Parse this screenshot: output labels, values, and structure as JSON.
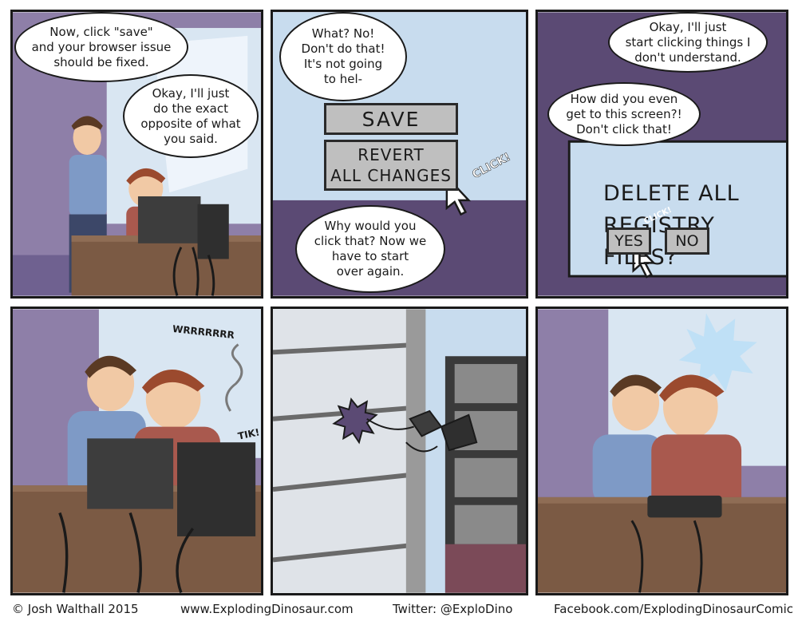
{
  "panel1": {
    "bubble_left": "Now, click \"save\"\nand your browser issue\nshould be fixed.",
    "bubble_right": "Okay, I'll just\ndo the exact\nopposite of what\nyou said."
  },
  "panel2": {
    "bubble_top": "What? No!\nDon't do that!\nIt's not going\nto hel-",
    "save_button": "SAVE",
    "revert_button": "REVERT\nALL CHANGES",
    "sfx_click": "CLICK!",
    "bubble_bottom": "Why would you\nclick that? Now we\nhave to start\nover again."
  },
  "panel3": {
    "bubble_top": "Okay, I'll just\nstart clicking things I\ndon't understand.",
    "bubble_mid": "How did you even\nget to this screen?!\nDon't click that!",
    "dialog_text": "DELETE ALL\nREGISTRY FILES?",
    "yes_button": "YES",
    "no_button": "NO",
    "sfx_click": "CLICK!"
  },
  "panel4": {
    "sfx_whirr": "WRRRRRRR",
    "sfx_tik": "TIK!"
  },
  "footer": {
    "copyright": "© Josh Walthall 2015",
    "website": "www.ExplodingDinosaur.com",
    "twitter": "Twitter: @ExploDino",
    "facebook": "Facebook.com/ExplodingDinosaurComic"
  },
  "colors": {
    "purple_wall": "#8e7fa8",
    "light_blue": "#c8dcee",
    "desk": "#7b5a44",
    "shirt_blue": "#7e9ac6",
    "shirt_red": "#a9594e",
    "hair": "#5a3a24",
    "monitor": "#3d3d3d",
    "dark_purple": "#5b4a74"
  }
}
